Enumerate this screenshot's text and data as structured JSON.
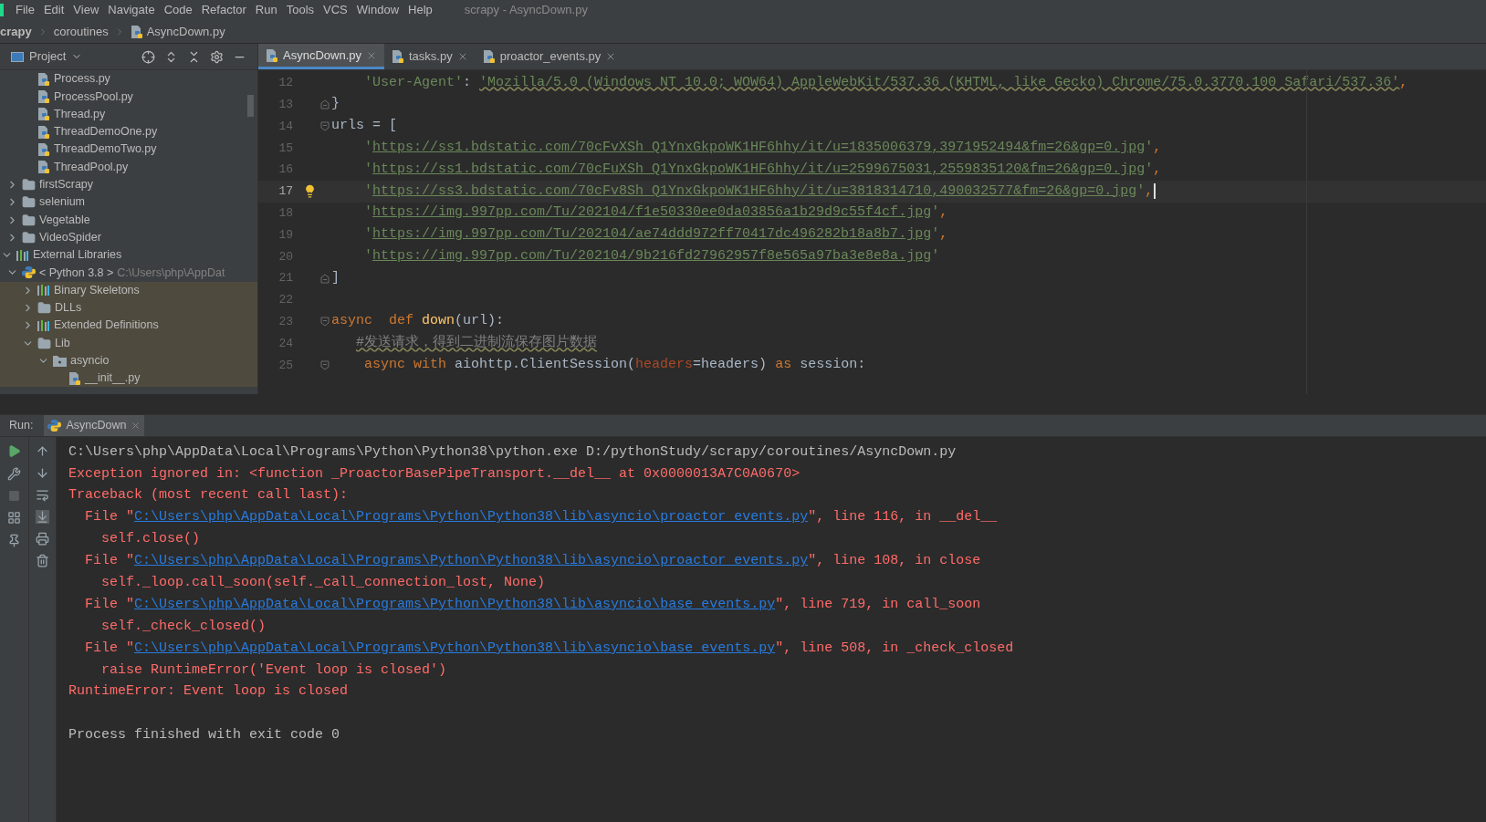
{
  "menu": {
    "items": [
      "File",
      "Edit",
      "View",
      "Navigate",
      "Code",
      "Refactor",
      "Run",
      "Tools",
      "VCS",
      "Window",
      "Help"
    ],
    "title": "scrapy - AsyncDown.py"
  },
  "breadcrumb": [
    {
      "label": "crapy",
      "kind": "root"
    },
    {
      "label": "coroutines",
      "kind": "folder"
    },
    {
      "label": "AsyncDown.py",
      "kind": "file"
    }
  ],
  "project_panel": {
    "title": "Project",
    "tree": [
      {
        "kind": "offscreen",
        "children": [
          {
            "kind": "offscreen",
            "children": [
              {
                "label": "Process.py",
                "kind": "file"
              },
              {
                "label": "ProcessPool.py",
                "kind": "file"
              },
              {
                "label": "Thread.py",
                "kind": "file"
              },
              {
                "label": "ThreadDemoOne.py",
                "kind": "file"
              },
              {
                "label": "ThreadDemoTwo.py",
                "kind": "file"
              },
              {
                "label": "ThreadPool.py",
                "kind": "file"
              }
            ]
          },
          {
            "label": "firstScrapy",
            "kind": "folder",
            "expanded": false
          },
          {
            "label": "selenium",
            "kind": "folder",
            "expanded": false
          },
          {
            "label": "Vegetable",
            "kind": "folder",
            "expanded": false
          },
          {
            "label": "VideoSpider",
            "kind": "folder",
            "expanded": false
          }
        ]
      },
      {
        "label": "External Libraries",
        "kind": "library",
        "expanded": true,
        "children": [
          {
            "label": "< Python 3.8 >",
            "path": "C:\\Users\\php\\AppDat",
            "kind": "python",
            "expanded": true,
            "children": [
              {
                "label": "Binary Skeletons",
                "kind": "library",
                "expanded": false,
                "shaded": true
              },
              {
                "label": "DLLs",
                "kind": "folder",
                "expanded": false,
                "shaded": true
              },
              {
                "label": "Extended Definitions",
                "kind": "library",
                "expanded": false,
                "shaded": true
              },
              {
                "label": "Lib",
                "kind": "folder",
                "expanded": true,
                "shaded": true,
                "children": [
                  {
                    "label": "asyncio",
                    "kind": "package",
                    "expanded": true,
                    "shaded": true,
                    "children": [
                      {
                        "label": "__init__.py",
                        "kind": "file",
                        "shaded": true
                      }
                    ]
                  }
                ]
              }
            ]
          }
        ]
      }
    ]
  },
  "tabs": [
    {
      "label": "AsyncDown.py",
      "selected": true
    },
    {
      "label": "tasks.py",
      "selected": false
    },
    {
      "label": "proactor_events.py",
      "selected": false
    }
  ],
  "editor": {
    "lines": [
      {
        "number": "12",
        "tokens": [
          {
            "t": "    'User-Agent'",
            "color": "#6a8759"
          },
          {
            "t": ": ",
            "color": "#a9b7c6"
          },
          {
            "t": "'Mozilla/5.0 (Windows NT 10.0; WOW64) AppleWebKit/537.36 (KHTML, like Gecko) Chrome/75.0.3770.100 Safari/537.36'",
            "color": "#6a8759",
            "wavy": true
          },
          {
            "t": ",",
            "color": "#cc7832"
          }
        ]
      },
      {
        "number": "13",
        "fold_end": true,
        "tokens": [
          {
            "t": "}",
            "color": "#a9b7c6"
          }
        ]
      },
      {
        "number": "14",
        "fold_start": true,
        "tokens": [
          {
            "t": "urls = [",
            "color": "#a9b7c6"
          }
        ]
      },
      {
        "number": "15",
        "tokens": [
          {
            "t": "    '",
            "color": "#6a8759"
          },
          {
            "t": "https://ss1.bdstatic.com/70cFvXSh_Q1YnxGkpoWK1HF6hhy/it/u=1835006379,3971952494&fm=26&gp=0.jpg",
            "color": "#6a8759",
            "underline": true
          },
          {
            "t": "'",
            "color": "#6a8759"
          },
          {
            "t": ",",
            "color": "#cc7832"
          }
        ]
      },
      {
        "number": "16",
        "tokens": [
          {
            "t": "    '",
            "color": "#6a8759"
          },
          {
            "t": "https://ss1.bdstatic.com/70cFuXSh_Q1YnxGkpoWK1HF6hhy/it/u=2599675031,2559835120&fm=26&gp=0.jpg",
            "color": "#6a8759",
            "underline": true
          },
          {
            "t": "'",
            "color": "#6a8759"
          },
          {
            "t": ",",
            "color": "#cc7832"
          }
        ]
      },
      {
        "number": "17",
        "current": true,
        "bulb": true,
        "caret": true,
        "tokens": [
          {
            "t": "    '",
            "color": "#6a8759"
          },
          {
            "t": "https://ss3.bdstatic.com/70cFv8Sh_Q1YnxGkpoWK1HF6hhy/it/u=3818314710,490032577&fm=26&gp=0.jpg",
            "color": "#6a8759",
            "underline": true
          },
          {
            "t": "'",
            "color": "#6a8759"
          },
          {
            "t": ",",
            "color": "#cc7832"
          }
        ]
      },
      {
        "number": "18",
        "tokens": [
          {
            "t": "    '",
            "color": "#6a8759"
          },
          {
            "t": "https://img.997pp.com/Tu/202104/f1e50330ee0da03856a1b29d9c55f4cf.jpg",
            "color": "#6a8759",
            "underline": true
          },
          {
            "t": "'",
            "color": "#6a8759"
          },
          {
            "t": ",",
            "color": "#cc7832"
          }
        ]
      },
      {
        "number": "19",
        "tokens": [
          {
            "t": "    '",
            "color": "#6a8759"
          },
          {
            "t": "https://img.997pp.com/Tu/202104/ae74ddd972ff70417dc496282b18a8b7.jpg",
            "color": "#6a8759",
            "underline": true
          },
          {
            "t": "'",
            "color": "#6a8759"
          },
          {
            "t": ",",
            "color": "#cc7832"
          }
        ]
      },
      {
        "number": "20",
        "tokens": [
          {
            "t": "    '",
            "color": "#6a8759"
          },
          {
            "t": "https://img.997pp.com/Tu/202104/9b216fd27962957f8e565a97ba3e8e8a.jpg",
            "color": "#6a8759",
            "underline": true
          },
          {
            "t": "'",
            "color": "#6a8759"
          }
        ]
      },
      {
        "number": "21",
        "fold_end": true,
        "tokens": [
          {
            "t": "]",
            "color": "#a9b7c6"
          }
        ]
      },
      {
        "number": "22"
      },
      {
        "number": "23",
        "fold_start": true,
        "tokens": [
          {
            "t": "async  def ",
            "color": "#cc7832"
          },
          {
            "t": "down",
            "color": "#ffc66d"
          },
          {
            "t": "(url):",
            "color": "#a9b7c6"
          }
        ]
      },
      {
        "number": "24",
        "tokens": [
          {
            "t": "   #发送请求，得到二进制流保存图片数据",
            "color": "#808080",
            "wavy": true
          }
        ]
      },
      {
        "number": "25",
        "fold_start": true,
        "tokens": [
          {
            "t": "    async with ",
            "color": "#cc7832"
          },
          {
            "t": "aiohttp.ClientSession(",
            "color": "#a9b7c6"
          },
          {
            "t": "headers",
            "color": "#aa4926"
          },
          {
            "t": "=headers) ",
            "color": "#a9b7c6"
          },
          {
            "t": "as ",
            "color": "#cc7832"
          },
          {
            "t": "session:",
            "color": "#a9b7c6"
          }
        ]
      }
    ]
  },
  "run_panel": {
    "label": "Run:",
    "tab": {
      "label": "AsyncDown",
      "selected": true
    },
    "console": [
      {
        "segments": [
          {
            "t": "C:\\Users\\php\\AppData\\Local\\Programs\\Python\\Python38\\python.exe D:/pythonStudy/scrapy/coroutines/AsyncDown.py",
            "color": "#bbbbbb"
          }
        ]
      },
      {
        "segments": [
          {
            "t": "Exception ignored in: <function _ProactorBasePipeTransport.__del__ at 0x0000013A7C0A0670>",
            "color": "#ff6b68"
          }
        ]
      },
      {
        "segments": [
          {
            "t": "Traceback (most recent call last):",
            "color": "#ff6b68"
          }
        ]
      },
      {
        "segments": [
          {
            "t": "  File \"",
            "color": "#ff6b68"
          },
          {
            "t": "C:\\Users\\php\\AppData\\Local\\Programs\\Python\\Python38\\lib\\asyncio\\proactor_events.py",
            "color": "#287bde",
            "link": true
          },
          {
            "t": "\", line 116, in __del__",
            "color": "#ff6b68"
          }
        ]
      },
      {
        "segments": [
          {
            "t": "    self.close()",
            "color": "#ff6b68"
          }
        ]
      },
      {
        "segments": [
          {
            "t": "  File \"",
            "color": "#ff6b68"
          },
          {
            "t": "C:\\Users\\php\\AppData\\Local\\Programs\\Python\\Python38\\lib\\asyncio\\proactor_events.py",
            "color": "#287bde",
            "link": true
          },
          {
            "t": "\", line 108, in close",
            "color": "#ff6b68"
          }
        ]
      },
      {
        "segments": [
          {
            "t": "    self._loop.call_soon(self._call_connection_lost, None)",
            "color": "#ff6b68"
          }
        ]
      },
      {
        "segments": [
          {
            "t": "  File \"",
            "color": "#ff6b68"
          },
          {
            "t": "C:\\Users\\php\\AppData\\Local\\Programs\\Python\\Python38\\lib\\asyncio\\base_events.py",
            "color": "#287bde",
            "link": true
          },
          {
            "t": "\", line 719, in call_soon",
            "color": "#ff6b68"
          }
        ]
      },
      {
        "segments": [
          {
            "t": "    self._check_closed()",
            "color": "#ff6b68"
          }
        ]
      },
      {
        "segments": [
          {
            "t": "  File \"",
            "color": "#ff6b68"
          },
          {
            "t": "C:\\Users\\php\\AppData\\Local\\Programs\\Python\\Python38\\lib\\asyncio\\base_events.py",
            "color": "#287bde",
            "link": true
          },
          {
            "t": "\", line 508, in _check_closed",
            "color": "#ff6b68"
          }
        ]
      },
      {
        "segments": [
          {
            "t": "    raise RuntimeError('Event loop is closed')",
            "color": "#ff6b68"
          }
        ]
      },
      {
        "segments": [
          {
            "t": "RuntimeError: Event loop is closed",
            "color": "#ff6b68"
          }
        ]
      },
      {
        "kind": "status",
        "segments": [
          {
            "t": "Process finished with exit code 0",
            "color": "#bbbbbb"
          }
        ]
      }
    ]
  }
}
